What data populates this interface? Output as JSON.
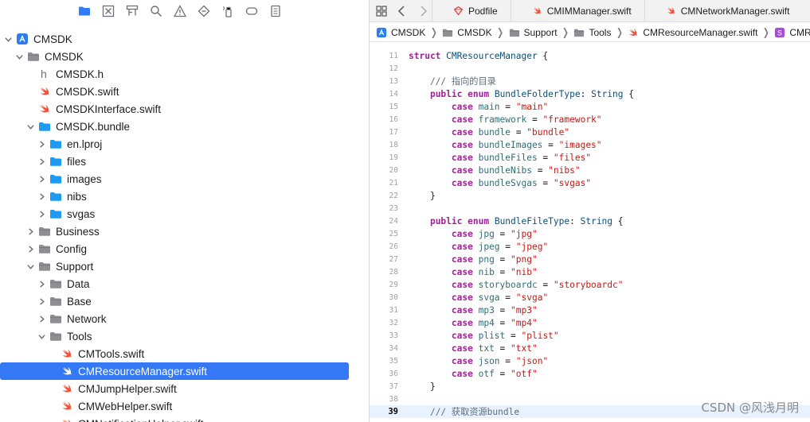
{
  "navigator": {
    "toolbar_icons": [
      "folder-icon",
      "x-square-icon",
      "hierarchy-icon",
      "search-icon",
      "warning-icon",
      "diamond-icon",
      "spray-icon",
      "tag-icon",
      "report-icon"
    ],
    "tree": [
      {
        "label": "CMSDK",
        "depth": 0,
        "expanded": true,
        "has_disclosure": true,
        "icon": "project-icon"
      },
      {
        "label": "CMSDK",
        "depth": 1,
        "expanded": true,
        "has_disclosure": true,
        "icon": "folder-gray-icon"
      },
      {
        "label": "CMSDK.h",
        "depth": 2,
        "has_disclosure": false,
        "icon": "header-file-icon"
      },
      {
        "label": "CMSDK.swift",
        "depth": 2,
        "has_disclosure": false,
        "icon": "swift-icon"
      },
      {
        "label": "CMSDKInterface.swift",
        "depth": 2,
        "has_disclosure": false,
        "icon": "swift-icon"
      },
      {
        "label": "CMSDK.bundle",
        "depth": 2,
        "expanded": true,
        "has_disclosure": true,
        "icon": "folder-blue-icon"
      },
      {
        "label": "en.lproj",
        "depth": 3,
        "expanded": false,
        "has_disclosure": true,
        "icon": "folder-blue-icon"
      },
      {
        "label": "files",
        "depth": 3,
        "expanded": false,
        "has_disclosure": true,
        "icon": "folder-blue-icon"
      },
      {
        "label": "images",
        "depth": 3,
        "expanded": false,
        "has_disclosure": true,
        "icon": "folder-blue-icon"
      },
      {
        "label": "nibs",
        "depth": 3,
        "expanded": false,
        "has_disclosure": true,
        "icon": "folder-blue-icon"
      },
      {
        "label": "svgas",
        "depth": 3,
        "expanded": false,
        "has_disclosure": true,
        "icon": "folder-blue-icon"
      },
      {
        "label": "Business",
        "depth": 2,
        "expanded": false,
        "has_disclosure": true,
        "icon": "folder-gray-icon"
      },
      {
        "label": "Config",
        "depth": 2,
        "expanded": false,
        "has_disclosure": true,
        "icon": "folder-gray-icon"
      },
      {
        "label": "Support",
        "depth": 2,
        "expanded": true,
        "has_disclosure": true,
        "icon": "folder-gray-icon"
      },
      {
        "label": "Data",
        "depth": 3,
        "expanded": false,
        "has_disclosure": true,
        "icon": "folder-gray-icon"
      },
      {
        "label": "Base",
        "depth": 3,
        "expanded": false,
        "has_disclosure": true,
        "icon": "folder-gray-icon"
      },
      {
        "label": "Network",
        "depth": 3,
        "expanded": false,
        "has_disclosure": true,
        "icon": "folder-gray-icon"
      },
      {
        "label": "Tools",
        "depth": 3,
        "expanded": true,
        "has_disclosure": true,
        "icon": "folder-gray-icon"
      },
      {
        "label": "CMTools.swift",
        "depth": 4,
        "has_disclosure": false,
        "icon": "swift-icon"
      },
      {
        "label": "CMResourceManager.swift",
        "depth": 4,
        "has_disclosure": false,
        "icon": "swift-icon",
        "selected": true
      },
      {
        "label": "CMJumpHelper.swift",
        "depth": 4,
        "has_disclosure": false,
        "icon": "swift-icon"
      },
      {
        "label": "CMWebHelper.swift",
        "depth": 4,
        "has_disclosure": false,
        "icon": "swift-icon"
      },
      {
        "label": "CMNotificationHelper.swift",
        "depth": 4,
        "has_disclosure": false,
        "icon": "swift-icon"
      }
    ]
  },
  "tabs": [
    {
      "label": "Podfile",
      "icon": "podfile-icon"
    },
    {
      "label": "CMIMManager.swift",
      "icon": "swift-icon"
    },
    {
      "label": "CMNetworkManager.swift",
      "icon": "swift-icon"
    }
  ],
  "breadcrumbs": [
    {
      "label": "CMSDK",
      "icon": "project-icon"
    },
    {
      "label": "CMSDK",
      "icon": "folder-gray-icon"
    },
    {
      "label": "Support",
      "icon": "folder-gray-icon"
    },
    {
      "label": "Tools",
      "icon": "folder-gray-icon"
    },
    {
      "label": "CMResourceManager.swift",
      "icon": "swift-icon"
    },
    {
      "label": "CMResourceManager",
      "icon": "struct-icon"
    }
  ],
  "code": {
    "current_line": 39,
    "lines": [
      {
        "num": 11,
        "tokens": [
          [
            "kw",
            "struct"
          ],
          [
            "plain",
            " "
          ],
          [
            "type",
            "CMResourceManager"
          ],
          [
            "plain",
            " {"
          ]
        ]
      },
      {
        "num": 12,
        "tokens": []
      },
      {
        "num": 13,
        "tokens": [
          [
            "plain",
            "    "
          ],
          [
            "cmt",
            "/// 指向的目录"
          ]
        ]
      },
      {
        "num": 14,
        "tokens": [
          [
            "plain",
            "    "
          ],
          [
            "kw",
            "public"
          ],
          [
            "plain",
            " "
          ],
          [
            "kw",
            "enum"
          ],
          [
            "plain",
            " "
          ],
          [
            "type",
            "BundleFolderType"
          ],
          [
            "plain",
            ": "
          ],
          [
            "type",
            "String"
          ],
          [
            "plain",
            " {"
          ]
        ]
      },
      {
        "num": 15,
        "tokens": [
          [
            "plain",
            "        "
          ],
          [
            "kw",
            "case"
          ],
          [
            "plain",
            " "
          ],
          [
            "ident",
            "main"
          ],
          [
            "plain",
            " = "
          ],
          [
            "str",
            "\"main\""
          ]
        ]
      },
      {
        "num": 16,
        "tokens": [
          [
            "plain",
            "        "
          ],
          [
            "kw",
            "case"
          ],
          [
            "plain",
            " "
          ],
          [
            "ident",
            "framework"
          ],
          [
            "plain",
            " = "
          ],
          [
            "str",
            "\"framework\""
          ]
        ]
      },
      {
        "num": 17,
        "tokens": [
          [
            "plain",
            "        "
          ],
          [
            "kw",
            "case"
          ],
          [
            "plain",
            " "
          ],
          [
            "ident",
            "bundle"
          ],
          [
            "plain",
            " = "
          ],
          [
            "str",
            "\"bundle\""
          ]
        ]
      },
      {
        "num": 18,
        "tokens": [
          [
            "plain",
            "        "
          ],
          [
            "kw",
            "case"
          ],
          [
            "plain",
            " "
          ],
          [
            "ident",
            "bundleImages"
          ],
          [
            "plain",
            " = "
          ],
          [
            "str",
            "\"images\""
          ]
        ]
      },
      {
        "num": 19,
        "tokens": [
          [
            "plain",
            "        "
          ],
          [
            "kw",
            "case"
          ],
          [
            "plain",
            " "
          ],
          [
            "ident",
            "bundleFiles"
          ],
          [
            "plain",
            " = "
          ],
          [
            "str",
            "\"files\""
          ]
        ]
      },
      {
        "num": 20,
        "tokens": [
          [
            "plain",
            "        "
          ],
          [
            "kw",
            "case"
          ],
          [
            "plain",
            " "
          ],
          [
            "ident",
            "bundleNibs"
          ],
          [
            "plain",
            " = "
          ],
          [
            "str",
            "\"nibs\""
          ]
        ]
      },
      {
        "num": 21,
        "tokens": [
          [
            "plain",
            "        "
          ],
          [
            "kw",
            "case"
          ],
          [
            "plain",
            " "
          ],
          [
            "ident",
            "bundleSvgas"
          ],
          [
            "plain",
            " = "
          ],
          [
            "str",
            "\"svgas\""
          ]
        ]
      },
      {
        "num": 22,
        "tokens": [
          [
            "plain",
            "    }"
          ]
        ]
      },
      {
        "num": 23,
        "tokens": []
      },
      {
        "num": 24,
        "tokens": [
          [
            "plain",
            "    "
          ],
          [
            "kw",
            "public"
          ],
          [
            "plain",
            " "
          ],
          [
            "kw",
            "enum"
          ],
          [
            "plain",
            " "
          ],
          [
            "type",
            "BundleFileType"
          ],
          [
            "plain",
            ": "
          ],
          [
            "type",
            "String"
          ],
          [
            "plain",
            " {"
          ]
        ]
      },
      {
        "num": 25,
        "tokens": [
          [
            "plain",
            "        "
          ],
          [
            "kw",
            "case"
          ],
          [
            "plain",
            " "
          ],
          [
            "ident",
            "jpg"
          ],
          [
            "plain",
            " = "
          ],
          [
            "str",
            "\"jpg\""
          ]
        ]
      },
      {
        "num": 26,
        "tokens": [
          [
            "plain",
            "        "
          ],
          [
            "kw",
            "case"
          ],
          [
            "plain",
            " "
          ],
          [
            "ident",
            "jpeg"
          ],
          [
            "plain",
            " = "
          ],
          [
            "str",
            "\"jpeg\""
          ]
        ]
      },
      {
        "num": 27,
        "tokens": [
          [
            "plain",
            "        "
          ],
          [
            "kw",
            "case"
          ],
          [
            "plain",
            " "
          ],
          [
            "ident",
            "png"
          ],
          [
            "plain",
            " = "
          ],
          [
            "str",
            "\"png\""
          ]
        ]
      },
      {
        "num": 28,
        "tokens": [
          [
            "plain",
            "        "
          ],
          [
            "kw",
            "case"
          ],
          [
            "plain",
            " "
          ],
          [
            "ident",
            "nib"
          ],
          [
            "plain",
            " = "
          ],
          [
            "str",
            "\"nib\""
          ]
        ]
      },
      {
        "num": 29,
        "tokens": [
          [
            "plain",
            "        "
          ],
          [
            "kw",
            "case"
          ],
          [
            "plain",
            " "
          ],
          [
            "ident",
            "storyboardc"
          ],
          [
            "plain",
            " = "
          ],
          [
            "str",
            "\"storyboardc\""
          ]
        ]
      },
      {
        "num": 30,
        "tokens": [
          [
            "plain",
            "        "
          ],
          [
            "kw",
            "case"
          ],
          [
            "plain",
            " "
          ],
          [
            "ident",
            "svga"
          ],
          [
            "plain",
            " = "
          ],
          [
            "str",
            "\"svga\""
          ]
        ]
      },
      {
        "num": 31,
        "tokens": [
          [
            "plain",
            "        "
          ],
          [
            "kw",
            "case"
          ],
          [
            "plain",
            " "
          ],
          [
            "ident",
            "mp3"
          ],
          [
            "plain",
            " = "
          ],
          [
            "str",
            "\"mp3\""
          ]
        ]
      },
      {
        "num": 32,
        "tokens": [
          [
            "plain",
            "        "
          ],
          [
            "kw",
            "case"
          ],
          [
            "plain",
            " "
          ],
          [
            "ident",
            "mp4"
          ],
          [
            "plain",
            " = "
          ],
          [
            "str",
            "\"mp4\""
          ]
        ]
      },
      {
        "num": 33,
        "tokens": [
          [
            "plain",
            "        "
          ],
          [
            "kw",
            "case"
          ],
          [
            "plain",
            " "
          ],
          [
            "ident",
            "plist"
          ],
          [
            "plain",
            " = "
          ],
          [
            "str",
            "\"plist\""
          ]
        ]
      },
      {
        "num": 34,
        "tokens": [
          [
            "plain",
            "        "
          ],
          [
            "kw",
            "case"
          ],
          [
            "plain",
            " "
          ],
          [
            "ident",
            "txt"
          ],
          [
            "plain",
            " = "
          ],
          [
            "str",
            "\"txt\""
          ]
        ]
      },
      {
        "num": 35,
        "tokens": [
          [
            "plain",
            "        "
          ],
          [
            "kw",
            "case"
          ],
          [
            "plain",
            " "
          ],
          [
            "ident",
            "json"
          ],
          [
            "plain",
            " = "
          ],
          [
            "str",
            "\"json\""
          ]
        ]
      },
      {
        "num": 36,
        "tokens": [
          [
            "plain",
            "        "
          ],
          [
            "kw",
            "case"
          ],
          [
            "plain",
            " "
          ],
          [
            "ident",
            "otf"
          ],
          [
            "plain",
            " = "
          ],
          [
            "str",
            "\"otf\""
          ]
        ]
      },
      {
        "num": 37,
        "tokens": [
          [
            "plain",
            "    }"
          ]
        ]
      },
      {
        "num": 38,
        "tokens": []
      },
      {
        "num": 39,
        "tokens": [
          [
            "plain",
            "    "
          ],
          [
            "cmt",
            "/// 获取资源bundle"
          ]
        ]
      }
    ]
  },
  "watermark": "CSDN @风浅月明",
  "colors": {
    "selection": "#3478f6",
    "swift_orange": "#f05138",
    "folder_blue": "#1e9bf0",
    "folder_gray": "#8e8e93",
    "toolbar_blue": "#2f7cf6"
  }
}
